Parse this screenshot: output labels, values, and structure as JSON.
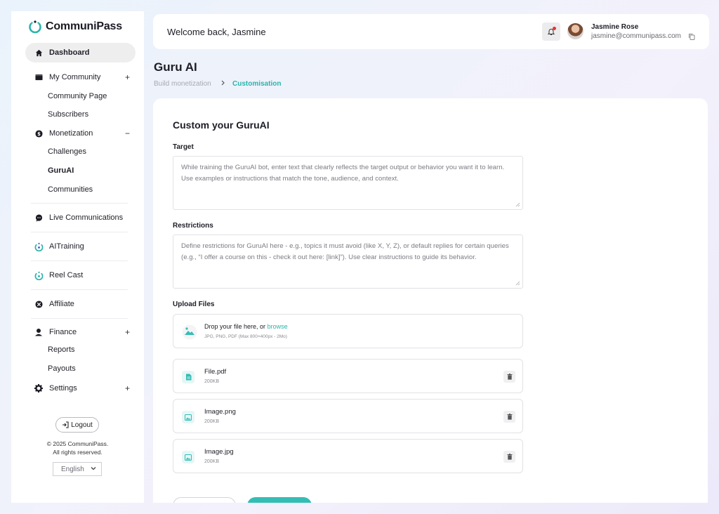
{
  "brand": {
    "name": "CommuniPass",
    "accent": "#2bb3ab"
  },
  "sidebar": {
    "dashboard": "Dashboard",
    "my_community": "My Community",
    "community_page": "Community Page",
    "subscribers": "Subscribers",
    "monetization": "Monetization",
    "challenges": "Challenges",
    "guruai": "GuruAI",
    "communities": "Communities",
    "live_communications": "Live Communications",
    "ai_training": "AITraining",
    "reel_cast": "Reel Cast",
    "affiliate": "Affiliate",
    "finance": "Finance",
    "reports": "Reports",
    "payouts": "Payouts",
    "settings": "Settings",
    "plus": "+",
    "minus": "−",
    "logout": "Logout",
    "copyright_line1": "© 2025 CommuniPass.",
    "copyright_line2": "All rights reserved.",
    "language": "English"
  },
  "header": {
    "welcome": "Welcome back, Jasmine",
    "user_name": "Jasmine Rose",
    "user_email": "jasmine@communipass.com"
  },
  "page": {
    "title": "Guru AI",
    "breadcrumb_parent": "Build monetization",
    "breadcrumb_current": "Customisation"
  },
  "form": {
    "title": "Custom your GuruAI",
    "target_label": "Target",
    "target_text": "While training the GuruAI bot, enter text that clearly reflects the target output or behavior you want it to learn. Use examples or instructions that match the tone, audience, and context.",
    "restrictions_label": "Restrictions",
    "restrictions_text": "Define restrictions for GuruAI here - e.g., topics it must avoid (like X, Y, Z), or default replies for certain queries (e.g., “I offer a course on this - check it out here: [link]”). Use clear instructions to guide its behavior.",
    "upload_label": "Upload Files",
    "drop_text": "Drop your file here, or",
    "browse": "browse",
    "upload_hint": "JPG, PNG, PDF (Max 800×400px - 2Mo)",
    "files": [
      {
        "name": "File.pdf",
        "size": "200KB",
        "icon": "pdf-file-icon"
      },
      {
        "name": "Image.png",
        "size": "200KB",
        "icon": "image-file-icon"
      },
      {
        "name": "Image.jpg",
        "size": "200KB",
        "icon": "image-file-icon"
      }
    ]
  }
}
